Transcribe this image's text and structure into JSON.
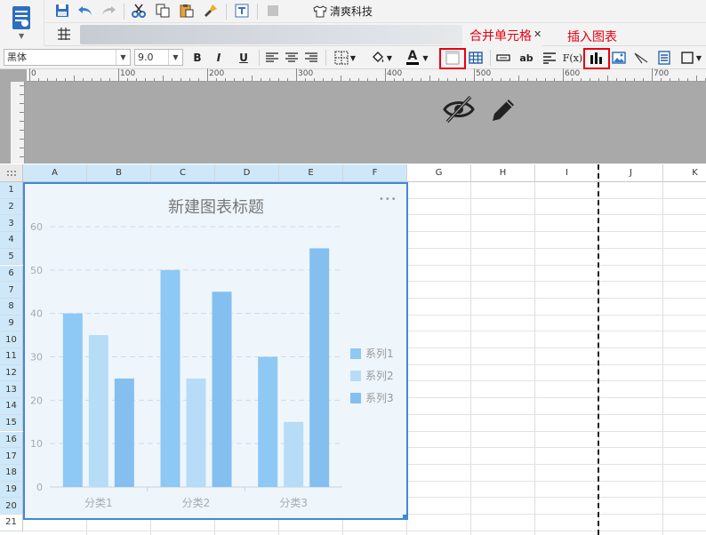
{
  "toolbar": {
    "brand_label": "清爽科技",
    "icons": [
      "save-icon",
      "undo-icon",
      "redo-icon",
      "cut-icon",
      "copy-icon",
      "paste-icon",
      "format-brush-icon",
      "text-preview-icon",
      "stamp-icon",
      "shirt-icon"
    ]
  },
  "tabs": {
    "active_label": "合并单元格",
    "close_glyph": "✕"
  },
  "format": {
    "font_name": "黑体",
    "font_size": "9.0",
    "bold": "B",
    "italic": "I",
    "underline": "U",
    "fx_label": "F(x)",
    "ab_label": "ab",
    "font_color_label": "A"
  },
  "annotations": {
    "merge_cells": "合并单元格",
    "insert_chart": "插入图表"
  },
  "ruler": {
    "marks": [
      "0",
      "100",
      "200",
      "300",
      "400",
      "500",
      "600",
      "700"
    ]
  },
  "sheet": {
    "columns": [
      "A",
      "B",
      "C",
      "D",
      "E",
      "F",
      "G",
      "H",
      "I",
      "J",
      "K"
    ],
    "rows": [
      "1",
      "2",
      "3",
      "4",
      "5",
      "6",
      "7",
      "8",
      "9",
      "10",
      "11",
      "12",
      "13",
      "14",
      "15",
      "16",
      "17",
      "18",
      "19",
      "20",
      "21"
    ]
  },
  "chart_data": {
    "type": "bar",
    "title": "新建图表标题",
    "categories": [
      "分类1",
      "分类2",
      "分类3"
    ],
    "series": [
      {
        "name": "系列1",
        "values": [
          40,
          50,
          30
        ],
        "color": "#8ec8f4"
      },
      {
        "name": "系列2",
        "values": [
          35,
          25,
          15
        ],
        "color": "#b6dcf7"
      },
      {
        "name": "系列3",
        "values": [
          25,
          45,
          55
        ],
        "color": "#85bff0"
      }
    ],
    "yticks": [
      "0",
      "10",
      "20",
      "30",
      "40",
      "50",
      "60"
    ],
    "ylim": [
      0,
      60
    ],
    "grid": true,
    "legend_position": "right",
    "more_glyph": "•••"
  }
}
